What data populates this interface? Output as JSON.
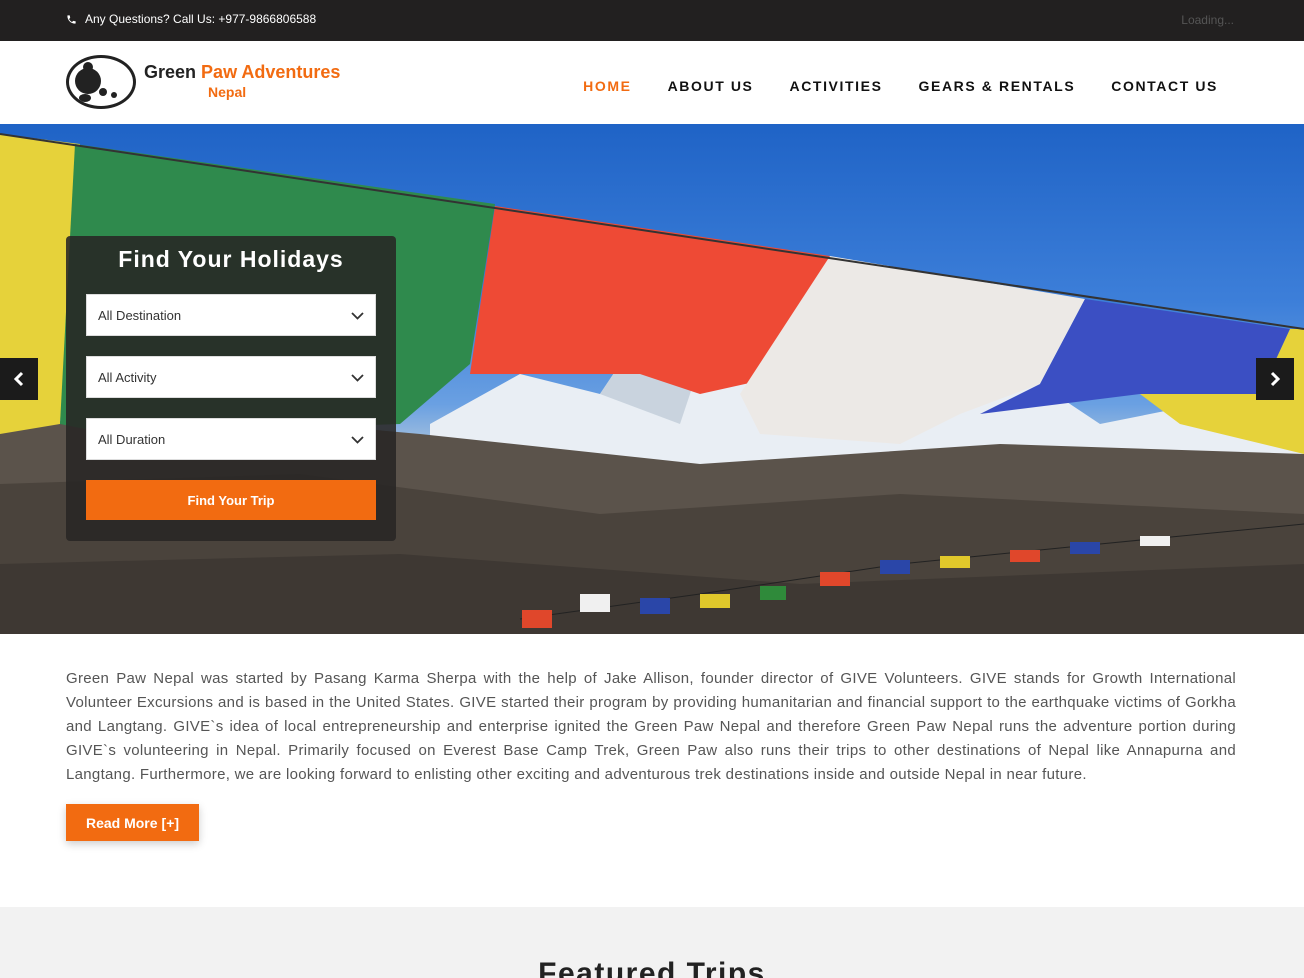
{
  "topbar": {
    "phone_text": "Any Questions? Call Us: +977-9866806588",
    "loading_text": "Loading..."
  },
  "logo": {
    "name_part1": "Green",
    "name_part2": "Paw Adventures",
    "subtitle": "Nepal",
    "badge_text": "GREEN PAW ADVENTURES NEPAL"
  },
  "nav": {
    "items": [
      {
        "label": "HOME",
        "active": true
      },
      {
        "label": "ABOUT US",
        "active": false
      },
      {
        "label": "ACTIVITIES",
        "active": false
      },
      {
        "label": "GEARS & RENTALS",
        "active": false
      },
      {
        "label": "CONTACT US",
        "active": false
      }
    ]
  },
  "finder": {
    "title": "Find Your Holidays",
    "destination": "All Destination",
    "activity": "All Activity",
    "duration": "All Duration",
    "button": "Find Your Trip"
  },
  "about": {
    "text": "Green Paw Nepal was started by Pasang Karma Sherpa with the help of Jake Allison, founder director of GIVE Volunteers. GIVE stands for Growth International Volunteer Excursions and is based in the United States. GIVE started their program by providing humanitarian and financial support to the earthquake victims of Gorkha and Langtang. GIVE`s idea of local entrepreneurship and enterprise ignited the Green Paw Nepal and therefore Green Paw Nepal runs the adventure portion during GIVE`s volunteering in Nepal. Primarily focused on Everest Base Camp Trek, Green Paw also runs their trips to other destinations of Nepal like Annapurna and Langtang. Furthermore, we are looking forward to enlisting other exciting and adventurous trek destinations inside and outside Nepal in near future.",
    "read_more": "Read More",
    "read_more_icon": "[+]"
  },
  "featured": {
    "title": "Featured Trips"
  },
  "colors": {
    "accent": "#f26b11",
    "topbar": "#222020",
    "section_bg": "#f2f2f2"
  },
  "icons": {
    "phone": "phone-icon",
    "prev": "chevron-left-icon",
    "next": "chevron-right-icon",
    "dropdown": "chevron-down-icon",
    "plus": "plus-icon"
  }
}
